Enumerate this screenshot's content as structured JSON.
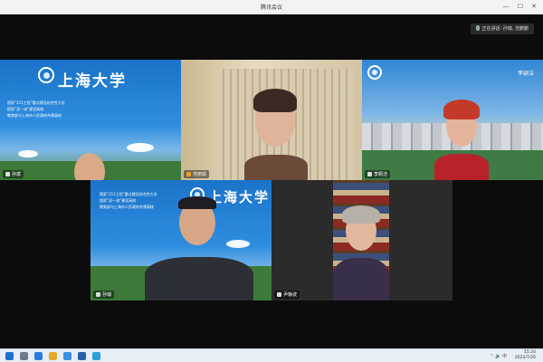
{
  "window": {
    "title": "腾讯会议"
  },
  "speaking_indicator": {
    "label": "正在讲话: 孙瑞, 范鹏鹏"
  },
  "participants": [
    {
      "name": "孙斌",
      "background_org": "上海大学",
      "slogans": [
        "国家“211工程”重点建设综合性大学",
        "国家“双一流”建设高校",
        "教育部与上海市人民政府共建高校"
      ]
    },
    {
      "name": "范丽娟"
    },
    {
      "name": "李颖洁",
      "overlay_name": "李颖洁"
    },
    {
      "name": "孙瑞",
      "background_org": "上海大学",
      "slogans": [
        "国家“211工程”重点建设综合性大学",
        "国家“双一流”建设高校",
        "教育部与上海市人民政府共建高校"
      ]
    },
    {
      "name": "尹静波"
    }
  ],
  "taskbar": {
    "time": "15:24",
    "date": "2022/7/20"
  },
  "colors": {
    "campus_blue": "#1e7fd0",
    "title_bar": "#f3f3f3",
    "background": "#0c0c0c"
  }
}
